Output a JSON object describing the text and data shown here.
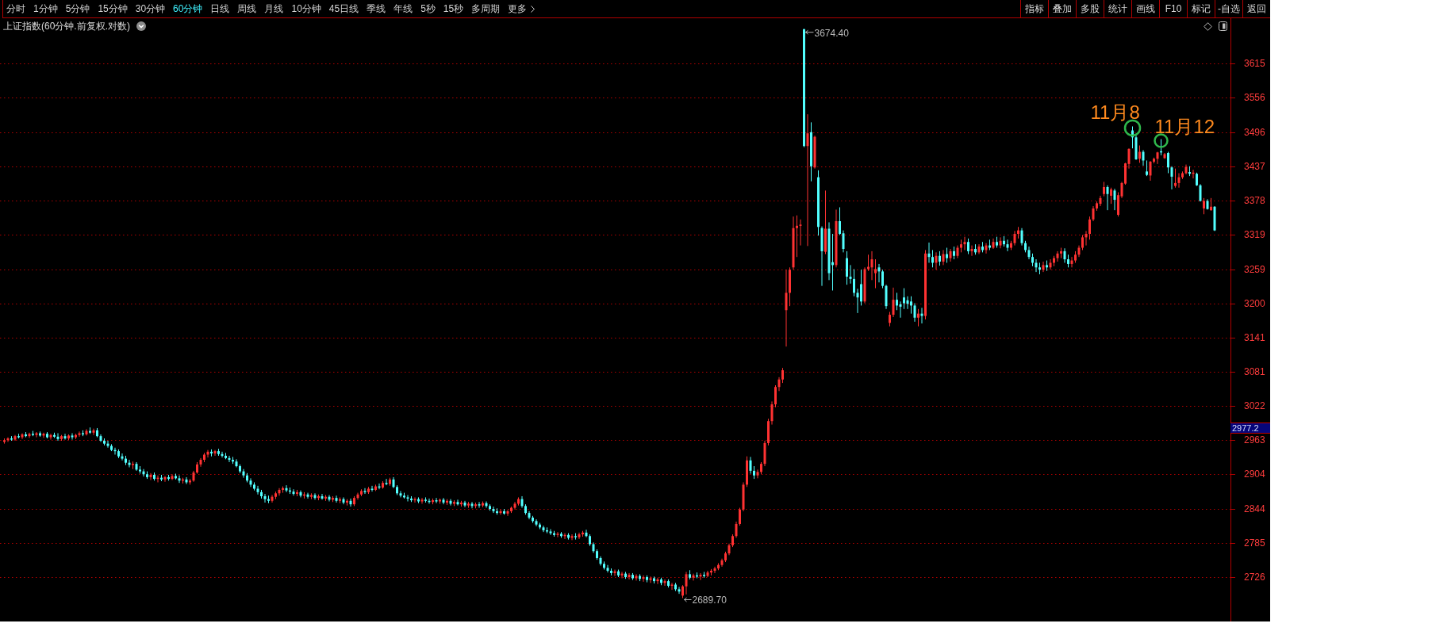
{
  "toolbar": {
    "periods": [
      {
        "label": "分时",
        "selected": false,
        "kind": "period"
      },
      {
        "label": "1分钟",
        "selected": false,
        "kind": "period"
      },
      {
        "label": "5分钟",
        "selected": false,
        "kind": "period"
      },
      {
        "label": "15分钟",
        "selected": false,
        "kind": "period"
      },
      {
        "label": "30分钟",
        "selected": false,
        "kind": "period"
      },
      {
        "label": "60分钟",
        "selected": true,
        "kind": "period"
      },
      {
        "label": "日线",
        "selected": false,
        "kind": "period"
      },
      {
        "label": "周线",
        "selected": false,
        "kind": "period"
      },
      {
        "label": "月线",
        "selected": false,
        "kind": "period"
      },
      {
        "label": "10分钟",
        "selected": false,
        "kind": "period"
      },
      {
        "label": "45日线",
        "selected": false,
        "kind": "period"
      },
      {
        "label": "季线",
        "selected": false,
        "kind": "period"
      },
      {
        "label": "年线",
        "selected": false,
        "kind": "period"
      },
      {
        "label": "5秒",
        "selected": false,
        "kind": "period"
      },
      {
        "label": "15秒",
        "selected": false,
        "kind": "period"
      },
      {
        "label": "多周期",
        "selected": false,
        "kind": "period"
      },
      {
        "label": "更多",
        "selected": false,
        "kind": "menu"
      }
    ],
    "tools": [
      "指标",
      "叠加",
      "多股",
      "统计",
      "画线",
      "F10",
      "标记",
      "-自选",
      "返回"
    ]
  },
  "chart": {
    "current_price": "2977.2",
    "high_label": "3674.40",
    "low_label": "2689.70",
    "chart_data": {
      "type": "candlestick",
      "title": "上证指数(60分钟.前复权.对数)",
      "ylim": [
        2649.2,
        3693.2
      ],
      "grid": true,
      "yticks": [
        3615,
        3556,
        3496,
        3437,
        3378,
        3319,
        3259,
        3200,
        3141,
        3081,
        3022,
        2963,
        2904,
        2844,
        2785,
        2726
      ],
      "annotations": [
        "11月8",
        "11月12"
      ],
      "ohlc": [
        [
          2960,
          2966,
          2957,
          2963
        ],
        [
          2963,
          2968,
          2960,
          2966
        ],
        [
          2966,
          2970,
          2962,
          2964
        ],
        [
          2964,
          2972,
          2962,
          2970
        ],
        [
          2970,
          2974,
          2966,
          2968
        ],
        [
          2968,
          2975,
          2965,
          2973
        ],
        [
          2973,
          2977,
          2968,
          2970
        ],
        [
          2970,
          2976,
          2967,
          2974
        ],
        [
          2974,
          2979,
          2970,
          2972
        ],
        [
          2972,
          2977,
          2968,
          2975
        ],
        [
          2975,
          2978,
          2969,
          2971
        ],
        [
          2971,
          2976,
          2967,
          2974
        ],
        [
          2974,
          2977,
          2966,
          2968
        ],
        [
          2968,
          2974,
          2964,
          2972
        ],
        [
          2972,
          2976,
          2967,
          2969
        ],
        [
          2969,
          2975,
          2962,
          2965
        ],
        [
          2965,
          2972,
          2962,
          2970
        ],
        [
          2970,
          2974,
          2964,
          2966
        ],
        [
          2966,
          2973,
          2963,
          2971
        ],
        [
          2971,
          2975,
          2964,
          2968
        ],
        [
          2968,
          2974,
          2965,
          2972
        ],
        [
          2972,
          2978,
          2969,
          2975
        ],
        [
          2975,
          2980,
          2970,
          2973
        ],
        [
          2973,
          2982,
          2971,
          2979
        ],
        [
          2979,
          2985,
          2974,
          2976
        ],
        [
          2976,
          2983,
          2972,
          2980
        ],
        [
          2980,
          2984,
          2968,
          2970
        ],
        [
          2970,
          2973,
          2960,
          2962
        ],
        [
          2962,
          2966,
          2954,
          2957
        ],
        [
          2957,
          2962,
          2950,
          2953
        ],
        [
          2953,
          2956,
          2944,
          2946
        ],
        [
          2946,
          2950,
          2938,
          2944
        ],
        [
          2944,
          2947,
          2932,
          2935
        ],
        [
          2935,
          2940,
          2928,
          2931
        ],
        [
          2931,
          2936,
          2920,
          2924
        ],
        [
          2924,
          2929,
          2916,
          2920
        ],
        [
          2920,
          2926,
          2913,
          2922
        ],
        [
          2922,
          2925,
          2910,
          2912
        ],
        [
          2912,
          2918,
          2905,
          2909
        ],
        [
          2909,
          2913,
          2900,
          2904
        ],
        [
          2904,
          2909,
          2896,
          2899
        ],
        [
          2899,
          2906,
          2894,
          2903
        ],
        [
          2903,
          2907,
          2893,
          2896
        ],
        [
          2896,
          2902,
          2890,
          2898
        ],
        [
          2898,
          2903,
          2892,
          2895
        ],
        [
          2895,
          2901,
          2891,
          2899
        ],
        [
          2899,
          2903,
          2893,
          2896
        ],
        [
          2896,
          2904,
          2894,
          2901
        ],
        [
          2901,
          2905,
          2895,
          2897
        ],
        [
          2897,
          2902,
          2889,
          2893
        ],
        [
          2893,
          2898,
          2888,
          2895
        ],
        [
          2895,
          2899,
          2887,
          2890
        ],
        [
          2890,
          2896,
          2886,
          2893
        ],
        [
          2893,
          2910,
          2891,
          2907
        ],
        [
          2907,
          2925,
          2905,
          2921
        ],
        [
          2921,
          2932,
          2917,
          2929
        ],
        [
          2929,
          2941,
          2925,
          2938
        ],
        [
          2938,
          2946,
          2933,
          2943
        ],
        [
          2943,
          2947,
          2935,
          2940
        ],
        [
          2940,
          2946,
          2936,
          2944
        ],
        [
          2944,
          2948,
          2936,
          2939
        ],
        [
          2939,
          2943,
          2933,
          2936
        ],
        [
          2936,
          2941,
          2930,
          2932
        ],
        [
          2932,
          2936,
          2925,
          2929
        ],
        [
          2929,
          2934,
          2922,
          2926
        ],
        [
          2926,
          2930,
          2916,
          2918
        ],
        [
          2918,
          2921,
          2906,
          2909
        ],
        [
          2909,
          2913,
          2898,
          2902
        ],
        [
          2902,
          2906,
          2890,
          2893
        ],
        [
          2893,
          2897,
          2882,
          2886
        ],
        [
          2886,
          2890,
          2876,
          2879
        ],
        [
          2879,
          2884,
          2869,
          2873
        ],
        [
          2873,
          2877,
          2862,
          2866
        ],
        [
          2866,
          2870,
          2855,
          2861
        ],
        [
          2861,
          2867,
          2854,
          2858
        ],
        [
          2858,
          2868,
          2855,
          2865
        ],
        [
          2865,
          2874,
          2861,
          2871
        ],
        [
          2871,
          2880,
          2867,
          2877
        ],
        [
          2877,
          2883,
          2872,
          2880
        ],
        [
          2880,
          2885,
          2873,
          2876
        ],
        [
          2876,
          2881,
          2870,
          2874
        ],
        [
          2874,
          2878,
          2867,
          2870
        ],
        [
          2870,
          2877,
          2866,
          2873
        ],
        [
          2873,
          2876,
          2864,
          2867
        ],
        [
          2867,
          2873,
          2862,
          2869
        ],
        [
          2869,
          2872,
          2862,
          2865
        ],
        [
          2865,
          2871,
          2861,
          2868
        ],
        [
          2868,
          2871,
          2860,
          2863
        ],
        [
          2863,
          2869,
          2859,
          2866
        ],
        [
          2866,
          2870,
          2860,
          2862
        ],
        [
          2862,
          2868,
          2858,
          2865
        ],
        [
          2865,
          2868,
          2857,
          2860
        ],
        [
          2860,
          2866,
          2856,
          2863
        ],
        [
          2863,
          2867,
          2855,
          2858
        ],
        [
          2858,
          2864,
          2854,
          2861
        ],
        [
          2861,
          2864,
          2852,
          2855
        ],
        [
          2855,
          2861,
          2850,
          2858
        ],
        [
          2858,
          2862,
          2848,
          2852
        ],
        [
          2852,
          2866,
          2849,
          2863
        ],
        [
          2863,
          2872,
          2860,
          2869
        ],
        [
          2869,
          2878,
          2866,
          2875
        ],
        [
          2875,
          2880,
          2870,
          2873
        ],
        [
          2873,
          2882,
          2870,
          2879
        ],
        [
          2879,
          2884,
          2874,
          2877
        ],
        [
          2877,
          2886,
          2875,
          2883
        ],
        [
          2883,
          2888,
          2878,
          2881
        ],
        [
          2881,
          2892,
          2879,
          2889
        ],
        [
          2889,
          2896,
          2885,
          2887
        ],
        [
          2887,
          2898,
          2884,
          2895
        ],
        [
          2895,
          2899,
          2880,
          2882
        ],
        [
          2882,
          2885,
          2868,
          2871
        ],
        [
          2871,
          2875,
          2864,
          2867
        ],
        [
          2867,
          2872,
          2862,
          2864
        ],
        [
          2864,
          2868,
          2857,
          2862
        ],
        [
          2862,
          2866,
          2856,
          2859
        ],
        [
          2859,
          2864,
          2855,
          2861
        ],
        [
          2861,
          2864,
          2854,
          2857
        ],
        [
          2857,
          2863,
          2853,
          2860
        ],
        [
          2860,
          2864,
          2855,
          2858
        ],
        [
          2858,
          2862,
          2853,
          2856
        ],
        [
          2856,
          2862,
          2852,
          2859
        ],
        [
          2859,
          2863,
          2854,
          2857
        ],
        [
          2857,
          2862,
          2853,
          2860
        ],
        [
          2860,
          2863,
          2852,
          2855
        ],
        [
          2855,
          2861,
          2851,
          2858
        ],
        [
          2858,
          2861,
          2850,
          2853
        ],
        [
          2853,
          2859,
          2849,
          2856
        ],
        [
          2856,
          2860,
          2850,
          2852
        ],
        [
          2852,
          2858,
          2848,
          2855
        ],
        [
          2855,
          2858,
          2847,
          2850
        ],
        [
          2850,
          2856,
          2846,
          2853
        ],
        [
          2853,
          2856,
          2845,
          2849
        ],
        [
          2849,
          2855,
          2845,
          2852
        ],
        [
          2852,
          2856,
          2846,
          2850
        ],
        [
          2850,
          2857,
          2847,
          2854
        ],
        [
          2854,
          2857,
          2846,
          2849
        ],
        [
          2849,
          2852,
          2841,
          2844
        ],
        [
          2844,
          2848,
          2837,
          2840
        ],
        [
          2840,
          2845,
          2834,
          2837
        ],
        [
          2837,
          2843,
          2834,
          2840
        ],
        [
          2840,
          2844,
          2834,
          2836
        ],
        [
          2836,
          2842,
          2832,
          2840
        ],
        [
          2840,
          2848,
          2837,
          2846
        ],
        [
          2846,
          2856,
          2843,
          2853
        ],
        [
          2853,
          2864,
          2850,
          2861
        ],
        [
          2861,
          2866,
          2846,
          2849
        ],
        [
          2849,
          2852,
          2834,
          2837
        ],
        [
          2837,
          2840,
          2826,
          2829
        ],
        [
          2829,
          2832,
          2820,
          2823
        ],
        [
          2823,
          2826,
          2814,
          2817
        ],
        [
          2817,
          2820,
          2809,
          2812
        ],
        [
          2812,
          2815,
          2804,
          2807
        ],
        [
          2807,
          2812,
          2802,
          2805
        ],
        [
          2805,
          2809,
          2799,
          2802
        ],
        [
          2802,
          2806,
          2796,
          2799
        ],
        [
          2799,
          2804,
          2795,
          2801
        ],
        [
          2801,
          2804,
          2794,
          2797
        ],
        [
          2797,
          2802,
          2792,
          2799
        ],
        [
          2799,
          2802,
          2791,
          2794
        ],
        [
          2794,
          2800,
          2790,
          2797
        ],
        [
          2797,
          2802,
          2791,
          2795
        ],
        [
          2795,
          2803,
          2792,
          2800
        ],
        [
          2800,
          2806,
          2796,
          2803
        ],
        [
          2803,
          2808,
          2795,
          2797
        ],
        [
          2797,
          2800,
          2780,
          2783
        ],
        [
          2783,
          2786,
          2768,
          2771
        ],
        [
          2771,
          2774,
          2756,
          2759
        ],
        [
          2759,
          2762,
          2746,
          2749
        ],
        [
          2749,
          2753,
          2739,
          2742
        ],
        [
          2742,
          2747,
          2734,
          2737
        ],
        [
          2737,
          2741,
          2729,
          2733
        ],
        [
          2733,
          2739,
          2728,
          2736
        ],
        [
          2736,
          2739,
          2726,
          2729
        ],
        [
          2729,
          2735,
          2724,
          2732
        ],
        [
          2732,
          2735,
          2723,
          2726
        ],
        [
          2726,
          2733,
          2722,
          2730
        ],
        [
          2730,
          2733,
          2721,
          2724
        ],
        [
          2724,
          2731,
          2720,
          2728
        ],
        [
          2728,
          2731,
          2719,
          2723
        ],
        [
          2723,
          2729,
          2718,
          2726
        ],
        [
          2726,
          2729,
          2717,
          2721
        ],
        [
          2721,
          2727,
          2716,
          2724
        ],
        [
          2724,
          2727,
          2715,
          2719
        ],
        [
          2719,
          2725,
          2714,
          2722
        ],
        [
          2722,
          2725,
          2712,
          2716
        ],
        [
          2716,
          2722,
          2711,
          2719
        ],
        [
          2719,
          2722,
          2708,
          2711
        ],
        [
          2711,
          2716,
          2704,
          2713
        ],
        [
          2713,
          2716,
          2702,
          2705
        ],
        [
          2705,
          2709,
          2697,
          2701
        ],
        [
          2694,
          2712,
          2689.7,
          2710
        ],
        [
          2710,
          2735,
          2696,
          2731
        ],
        [
          2731,
          2738,
          2722,
          2725
        ],
        [
          2725,
          2732,
          2720,
          2729
        ],
        [
          2729,
          2734,
          2724,
          2727
        ],
        [
          2727,
          2733,
          2721,
          2730
        ],
        [
          2730,
          2735,
          2725,
          2728
        ],
        [
          2728,
          2737,
          2726,
          2734
        ],
        [
          2734,
          2740,
          2729,
          2737
        ],
        [
          2737,
          2744,
          2733,
          2741
        ],
        [
          2741,
          2750,
          2738,
          2747
        ],
        [
          2747,
          2758,
          2744,
          2755
        ],
        [
          2755,
          2770,
          2752,
          2767
        ],
        [
          2767,
          2784,
          2764,
          2781
        ],
        [
          2781,
          2800,
          2778,
          2797
        ],
        [
          2797,
          2822,
          2794,
          2818
        ],
        [
          2818,
          2846,
          2815,
          2843
        ],
        [
          2843,
          2890,
          2840,
          2886
        ],
        [
          2886,
          2935,
          2882,
          2928
        ],
        [
          2928,
          2934,
          2905,
          2910
        ],
        [
          2910,
          2918,
          2896,
          2902
        ],
        [
          2902,
          2912,
          2897,
          2908
        ],
        [
          2908,
          2925,
          2904,
          2922
        ],
        [
          2922,
          2962,
          2918,
          2958
        ],
        [
          2958,
          3000,
          2954,
          2996
        ],
        [
          2996,
          3030,
          2990,
          3025
        ],
        [
          3025,
          3058,
          3020,
          3055
        ],
        [
          3055,
          3072,
          3048,
          3068
        ],
        [
          3068,
          3088,
          3062,
          3084
        ],
        [
          3188,
          3258,
          3125,
          3218
        ],
        [
          3218,
          3262,
          3195,
          3258
        ],
        [
          3262,
          3350,
          3258,
          3330
        ],
        [
          3330,
          3352,
          3280,
          3334
        ],
        [
          3334,
          3345,
          3300,
          3336
        ],
        [
          3674.4,
          3674.4,
          3470,
          3472
        ],
        [
          3472,
          3527,
          3299,
          3494
        ],
        [
          3496,
          3513,
          3411,
          3437
        ],
        [
          3435,
          3490,
          3433,
          3488
        ],
        [
          3418,
          3430,
          3317,
          3332
        ],
        [
          3330,
          3333,
          3230,
          3290
        ],
        [
          3289,
          3395,
          3285,
          3329
        ],
        [
          3329,
          3340,
          3240,
          3252
        ],
        [
          3271,
          3320,
          3222,
          3266
        ],
        [
          3266,
          3362,
          3262,
          3342
        ],
        [
          3342,
          3366,
          3318,
          3320
        ],
        [
          3321,
          3326,
          3288,
          3294
        ],
        [
          3278,
          3290,
          3232,
          3246
        ],
        [
          3246,
          3266,
          3234,
          3242
        ],
        [
          3242,
          3259,
          3212,
          3218
        ],
        [
          3218,
          3225,
          3183,
          3210
        ],
        [
          3233,
          3258,
          3196,
          3203
        ],
        [
          3203,
          3262,
          3200,
          3259
        ],
        [
          3259,
          3284,
          3256,
          3263
        ],
        [
          3262,
          3290,
          3240,
          3276
        ],
        [
          3252,
          3276,
          3226,
          3259
        ],
        [
          3262,
          3268,
          3236,
          3255
        ],
        [
          3255,
          3258,
          3226,
          3230
        ],
        [
          3230,
          3232,
          3190,
          3195
        ],
        [
          3166,
          3185,
          3160,
          3180
        ],
        [
          3180,
          3227,
          3176,
          3206
        ],
        [
          3206,
          3218,
          3188,
          3196
        ],
        [
          3198,
          3203,
          3175,
          3194
        ],
        [
          3210,
          3226,
          3190,
          3200
        ],
        [
          3205,
          3212,
          3190,
          3199
        ],
        [
          3203,
          3212,
          3182,
          3196
        ],
        [
          3196,
          3200,
          3168,
          3175
        ],
        [
          3175,
          3190,
          3160,
          3182
        ],
        [
          3182,
          3192,
          3165,
          3178
        ],
        [
          3178,
          3292,
          3172,
          3286
        ],
        [
          3286,
          3305,
          3270,
          3280
        ],
        [
          3280,
          3292,
          3262,
          3270
        ],
        [
          3270,
          3288,
          3258,
          3282
        ],
        [
          3282,
          3290,
          3265,
          3272
        ],
        [
          3272,
          3292,
          3266,
          3285
        ],
        [
          3285,
          3296,
          3270,
          3278
        ],
        [
          3278,
          3294,
          3272,
          3290
        ],
        [
          3290,
          3298,
          3276,
          3282
        ],
        [
          3282,
          3300,
          3278,
          3296
        ],
        [
          3296,
          3310,
          3288,
          3302
        ],
        [
          3302,
          3315,
          3292,
          3306
        ],
        [
          3306,
          3312,
          3285,
          3290
        ],
        [
          3290,
          3300,
          3282,
          3294
        ],
        [
          3294,
          3302,
          3284,
          3288
        ],
        [
          3288,
          3302,
          3285,
          3298
        ],
        [
          3298,
          3306,
          3288,
          3292
        ],
        [
          3292,
          3304,
          3286,
          3300
        ],
        [
          3300,
          3310,
          3292,
          3296
        ],
        [
          3296,
          3312,
          3294,
          3306
        ],
        [
          3306,
          3315,
          3296,
          3300
        ],
        [
          3300,
          3314,
          3295,
          3308
        ],
        [
          3308,
          3316,
          3298,
          3302
        ],
        [
          3302,
          3310,
          3290,
          3296
        ],
        [
          3296,
          3308,
          3292,
          3304
        ],
        [
          3304,
          3325,
          3300,
          3320
        ],
        [
          3320,
          3332,
          3312,
          3326
        ],
        [
          3326,
          3330,
          3300,
          3304
        ],
        [
          3304,
          3308,
          3288,
          3292
        ],
        [
          3292,
          3298,
          3276,
          3280
        ],
        [
          3280,
          3286,
          3264,
          3270
        ],
        [
          3270,
          3276,
          3254,
          3262
        ],
        [
          3262,
          3270,
          3250,
          3258
        ],
        [
          3258,
          3272,
          3254,
          3266
        ],
        [
          3266,
          3274,
          3256,
          3262
        ],
        [
          3262,
          3276,
          3258,
          3270
        ],
        [
          3270,
          3282,
          3264,
          3278
        ],
        [
          3278,
          3290,
          3272,
          3286
        ],
        [
          3286,
          3296,
          3278,
          3290
        ],
        [
          3290,
          3295,
          3270,
          3276
        ],
        [
          3276,
          3284,
          3262,
          3268
        ],
        [
          3268,
          3280,
          3262,
          3274
        ],
        [
          3274,
          3290,
          3270,
          3284
        ],
        [
          3284,
          3300,
          3280,
          3296
        ],
        [
          3296,
          3318,
          3292,
          3314
        ],
        [
          3314,
          3325,
          3300,
          3320
        ],
        [
          3320,
          3350,
          3310,
          3345
        ],
        [
          3345,
          3368,
          3342,
          3364
        ],
        [
          3364,
          3376,
          3360,
          3373
        ],
        [
          3372,
          3386,
          3368,
          3382
        ],
        [
          3389,
          3410,
          3385,
          3401
        ],
        [
          3401,
          3404,
          3361,
          3389
        ],
        [
          3386,
          3400,
          3372,
          3397
        ],
        [
          3395,
          3398,
          3361,
          3379
        ],
        [
          3353,
          3392,
          3350,
          3387
        ],
        [
          3385,
          3410,
          3382,
          3408
        ],
        [
          3407,
          3443,
          3405,
          3442
        ],
        [
          3441,
          3468,
          3433,
          3467
        ],
        [
          3499,
          3506,
          3468,
          3487
        ],
        [
          3487,
          3490,
          3448,
          3449
        ],
        [
          3450,
          3473,
          3443,
          3462
        ],
        [
          3462,
          3465,
          3438,
          3447
        ],
        [
          3428,
          3447,
          3420,
          3422
        ],
        [
          3421,
          3446,
          3412,
          3445
        ],
        [
          3445,
          3452,
          3442,
          3450
        ],
        [
          3450,
          3462,
          3441,
          3461
        ],
        [
          3463,
          3484,
          3456,
          3461
        ],
        [
          3451,
          3460,
          3450,
          3458
        ],
        [
          3460,
          3462,
          3425,
          3435
        ],
        [
          3435,
          3437,
          3397,
          3419
        ],
        [
          3403,
          3433,
          3400,
          3408
        ],
        [
          3408,
          3425,
          3400,
          3418
        ],
        [
          3418,
          3428,
          3415,
          3425
        ],
        [
          3425,
          3440,
          3423,
          3436
        ],
        [
          3427,
          3437,
          3420,
          3424
        ],
        [
          3424,
          3431,
          3416,
          3426
        ],
        [
          3424,
          3426,
          3403,
          3404
        ],
        [
          3404,
          3406,
          3376,
          3377
        ],
        [
          3364,
          3382,
          3354,
          3377
        ],
        [
          3377,
          3380,
          3362,
          3363
        ],
        [
          3361,
          3382,
          3360,
          3367
        ],
        [
          3367,
          3368,
          3325,
          3326
        ]
      ]
    }
  }
}
